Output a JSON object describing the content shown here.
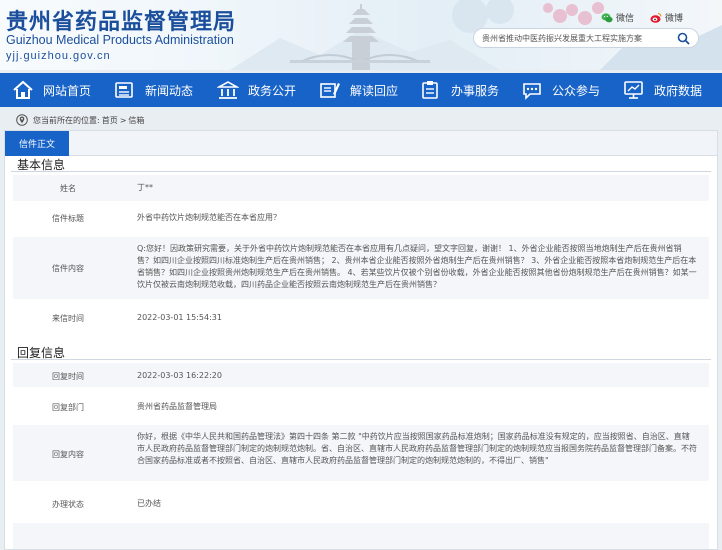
{
  "header": {
    "logo_cn": "贵州省药品监督管理局",
    "logo_en": "Guizhou Medical Products Administration",
    "logo_url": "yjj.guizhou.gov.cn",
    "wechat_label": "微信",
    "weibo_label": "微博",
    "search_value": "贵州省推动中医药振兴发展重大工程实施方案"
  },
  "nav": {
    "items": [
      {
        "label": "网站首页",
        "icon": "home-icon"
      },
      {
        "label": "新闻动态",
        "icon": "news-icon"
      },
      {
        "label": "政务公开",
        "icon": "government-icon"
      },
      {
        "label": "解读回应",
        "icon": "interpret-icon"
      },
      {
        "label": "办事服务",
        "icon": "service-icon"
      },
      {
        "label": "公众参与",
        "icon": "chat-icon"
      },
      {
        "label": "政府数据",
        "icon": "data-icon"
      }
    ]
  },
  "breadcrumb": {
    "prefix": "您当前所在的位置:",
    "home": "首页",
    "sep": ">",
    "current": "信箱"
  },
  "tab": {
    "label": "信件正文"
  },
  "basic": {
    "title": "基本信息",
    "name_label": "姓名",
    "name_value": "丁**",
    "subject_label": "信件标题",
    "subject_value": "外省中药饮片炮制规范能否在本省应用？",
    "content_label": "信件内容",
    "content_value": "Q:您好！因政策研究需要，关于外省中药饮片炮制规范能否在本省应用有几点疑问，望文字回复，谢谢！ 1、外省企业能否按照当地炮制生产后在贵州省销售？如四川企业按照四川标准炮制生产后在贵州销售； 2、贵州本省企业能否按照外省炮制生产后在贵州销售？ 3、外省企业能否按照本省炮制规范生产后在本省销售？如四川企业按照贵州炮制规范生产后在贵州销售。 4、若某些饮片仅被个别省份收载，外省企业能否按照其他省份炮制规范生产后在贵州销售？如某一饮片仅被云南炮制规范收载，四川药品企业能否按照云南炮制规范生产后在贵州销售？",
    "time_label": "来信时间",
    "time_value": "2022-03-01 15:54:31"
  },
  "reply": {
    "title": "回复信息",
    "time_label": "回复时间",
    "time_value": "2022-03-03 16:22:20",
    "dept_label": "回复部门",
    "dept_value": "贵州省药品监督管理局",
    "content_label": "回复内容",
    "content_value": "你好，根据《中华人民共和国药品管理法》第四十四条   第二款 \"中药饮片应当按照国家药品标准炮制；国家药品标准没有规定的，应当按照省、自治区、直辖市人民政府药品监督管理部门制定的炮制规范炮制。省、自治区、直辖市人民政府药品监督管理部门制定的炮制规范应当报国务院药品监督管理部门备案。不符合国家药品标准或者不按照省、自治区、直辖市人民政府药品监督管理部门制定的炮制规范炮制的，不得出厂、销售\"",
    "status_label": "办理状态",
    "status_value": "已办结"
  },
  "colors": {
    "nav_bg": "#1863c7",
    "logo_text": "#1b4f9c"
  }
}
